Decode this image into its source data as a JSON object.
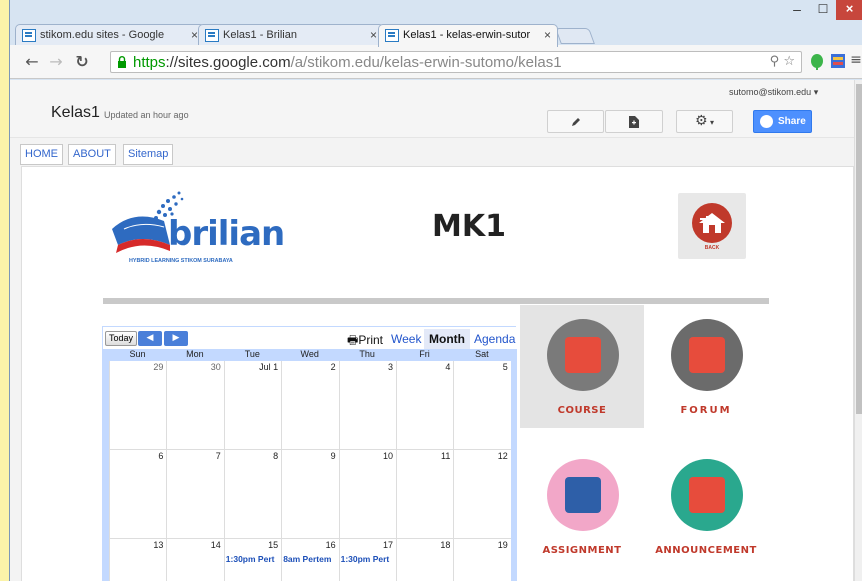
{
  "browser": {
    "tabs": [
      {
        "title": "stikom.edu sites - Google",
        "close": "×"
      },
      {
        "title": "Kelas1 - Brilian",
        "close": "×"
      },
      {
        "title": "Kelas1 - kelas-erwin-sutor",
        "close": "×"
      }
    ],
    "url_scheme": "https",
    "url_host": "://sites.google.com",
    "url_path": "/a/stikom.edu/kelas-erwin-sutomo/kelas1",
    "window": {
      "minimize": "–",
      "maximize": "☐",
      "close": "×"
    }
  },
  "site": {
    "title": "Kelas1",
    "updated": "Updated an hour ago",
    "user": "sutomo@stikom.edu",
    "user_caret": "▾",
    "share_label": "Share",
    "nav": [
      "HOME",
      "ABOUT",
      "Sitemap"
    ]
  },
  "page": {
    "heading": "MK1",
    "logo_text": "brilian",
    "logo_tagline": "HYBRID LEARNING STIKOM SURABAYA",
    "back_label": "BACK"
  },
  "calendar": {
    "today_label": "Today",
    "print_label": "Print",
    "views": [
      "Week",
      "Month",
      "Agenda"
    ],
    "active_view": "Month",
    "weekdays": [
      "Sun",
      "Mon",
      "Tue",
      "Wed",
      "Thu",
      "Fri",
      "Sat"
    ],
    "weeks": [
      [
        "29",
        "30",
        "Jul 1",
        "2",
        "3",
        "4",
        "5"
      ],
      [
        "6",
        "7",
        "8",
        "9",
        "10",
        "11",
        "12"
      ],
      [
        "13",
        "14",
        "15",
        "16",
        "17",
        "18",
        "19"
      ]
    ],
    "events": [
      {
        "week": 2,
        "day": 2,
        "text": "1:30pm Pert"
      },
      {
        "week": 2,
        "day": 3,
        "text": "8am Pertem"
      },
      {
        "week": 2,
        "day": 4,
        "text": "1:30pm Pert"
      }
    ]
  },
  "menu": [
    {
      "label": "COURSE",
      "color": "#7a7a7a",
      "accent": "#e74c3c"
    },
    {
      "label": "FORUM",
      "color": "#6b6b6b",
      "accent": "#e74c3c"
    },
    {
      "label": "ASSIGNMENT",
      "color": "#f2a7c8",
      "accent": "#2e5fa8"
    },
    {
      "label": "ANNOUNCEMENT",
      "color": "#2aa88e",
      "accent": "#e74c3c"
    }
  ]
}
